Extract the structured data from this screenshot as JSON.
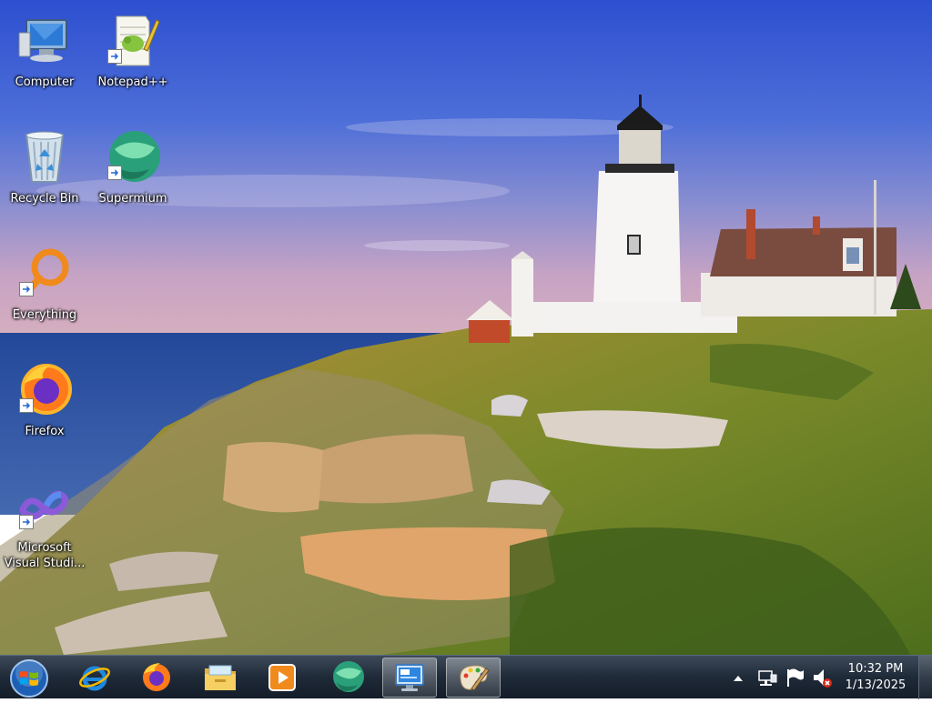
{
  "desktop": {
    "icons": [
      {
        "label": "Computer"
      },
      {
        "label": "Notepad++"
      },
      {
        "label": "Recycle Bin"
      },
      {
        "label": "Supermium"
      },
      {
        "label": "Everything"
      },
      {
        "label": "Firefox"
      },
      {
        "label": "Microsoft Visual Studi..."
      }
    ]
  },
  "taskbar": {
    "start_icon": "windows-start-orb",
    "pinned": [
      {
        "icon": "internet-explorer-icon"
      },
      {
        "icon": "firefox-icon"
      },
      {
        "icon": "file-explorer-icon"
      },
      {
        "icon": "media-player-icon"
      },
      {
        "icon": "supermium-icon"
      },
      {
        "icon": "remote-desktop-icon",
        "active": true
      },
      {
        "icon": "paint-icon",
        "active": true
      }
    ],
    "tray": {
      "icons": [
        "show-hidden-icons",
        "network-icon",
        "action-center-flag-icon",
        "volume-muted-icon"
      ],
      "time": "10:32 PM",
      "date": "1/13/2025"
    }
  }
}
